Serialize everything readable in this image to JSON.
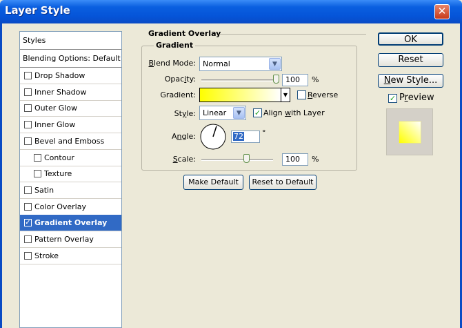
{
  "window": {
    "title": "Layer Style",
    "close": "✕"
  },
  "styles_panel": {
    "header": "Styles",
    "blending": "Blending Options: Default",
    "items": [
      {
        "label": "Drop Shadow",
        "checked": false
      },
      {
        "label": "Inner Shadow",
        "checked": false
      },
      {
        "label": "Outer Glow",
        "checked": false
      },
      {
        "label": "Inner Glow",
        "checked": false
      },
      {
        "label": "Bevel and Emboss",
        "checked": false
      },
      {
        "label": "Contour",
        "checked": false
      },
      {
        "label": "Texture",
        "checked": false
      },
      {
        "label": "Satin",
        "checked": false
      },
      {
        "label": "Color Overlay",
        "checked": false
      },
      {
        "label": "Gradient Overlay",
        "checked": true
      },
      {
        "label": "Pattern Overlay",
        "checked": false
      },
      {
        "label": "Stroke",
        "checked": false
      }
    ]
  },
  "gradient_overlay": {
    "section_title": "Gradient Overlay",
    "group_title": "Gradient",
    "blend_mode": {
      "label_u": "B",
      "label_rest": "lend Mode:",
      "value": "Normal"
    },
    "opacity": {
      "label_pre": "Opac",
      "label_u": "i",
      "label_rest": "ty:",
      "value": "100",
      "unit": "%",
      "level": 1.0
    },
    "gradient": {
      "label": "Gradient:",
      "reverse_pre": "",
      "reverse_u": "R",
      "reverse_rest": "everse",
      "reverse_checked": false
    },
    "style": {
      "label_pre": "St",
      "label_u": "y",
      "label_rest": "le:",
      "value": "Linear"
    },
    "align": {
      "label_pre": "Align ",
      "label_u": "w",
      "label_rest": "ith Layer",
      "checked": true
    },
    "angle": {
      "label_pre": "A",
      "label_u": "n",
      "label_rest": "gle:",
      "value": "72",
      "unit": "°"
    },
    "scale": {
      "label_u": "S",
      "label_rest": "cale:",
      "value": "100",
      "unit": "%",
      "level": 0.6
    },
    "make_default": "Make Default",
    "reset_default": "Reset to Default"
  },
  "actions": {
    "ok": "OK",
    "reset": "Reset",
    "new_style_u": "N",
    "new_style_rest": "ew Style...",
    "preview_pre": "P",
    "preview_u": "r",
    "preview_rest": "eview",
    "preview_checked": true
  },
  "colors": {
    "gradient_start": "#ffff00",
    "gradient_end": "#ffffff",
    "title_bar": "#0a5fe0",
    "selection": "#316ac5"
  }
}
